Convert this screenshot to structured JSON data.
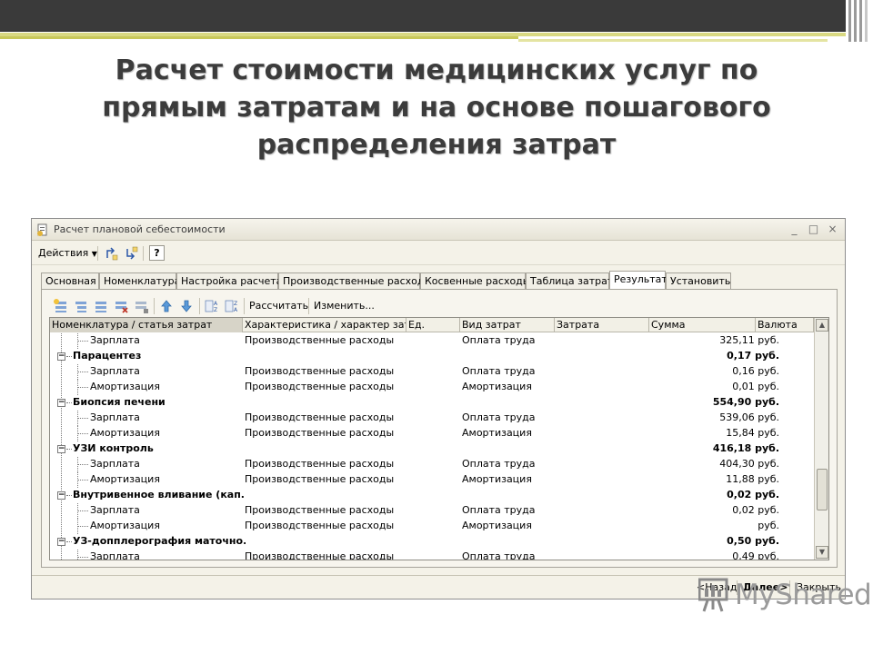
{
  "slide": {
    "title": "Расчет стоимости медицинских услуг по прямым затратам и на основе пошагового распределения затрат"
  },
  "window": {
    "title": "Расчет плановой себестоимости",
    "controls": [
      "_",
      "□",
      "×"
    ]
  },
  "menu": {
    "actions_label": "Действия",
    "help_label": "?"
  },
  "tabs": [
    "Основная",
    "Номенклатура",
    "Настройка расчета",
    "Производственные расходы",
    "Косвенные расходы",
    "Таблица затрат",
    "Результат",
    "Установить"
  ],
  "active_tab": "Результат",
  "toolbar": {
    "calculate_label": "Рассчитать",
    "edit_label": "Изменить..."
  },
  "grid": {
    "columns": [
      "Номенклатура / статья затрат",
      "Характеристика / характер затрат",
      "Ед.",
      "Вид затрат",
      "Затрата",
      "Сумма",
      "Валюта"
    ],
    "rows": [
      {
        "type": "item",
        "name": "Зарплата",
        "character": "Производственные расходы",
        "kind": "Оплата труда",
        "sum": "325,11 руб."
      },
      {
        "type": "group",
        "name": "Парацентез",
        "sum": "0,17 руб."
      },
      {
        "type": "item",
        "name": "Зарплата",
        "character": "Производственные расходы",
        "kind": "Оплата труда",
        "sum": "0,16 руб."
      },
      {
        "type": "item",
        "name": "Амортизация",
        "character": "Производственные расходы",
        "kind": "Амортизация",
        "sum": "0,01 руб."
      },
      {
        "type": "group",
        "name": "Биопсия печени",
        "sum": "554,90 руб."
      },
      {
        "type": "item",
        "name": "Зарплата",
        "character": "Производственные расходы",
        "kind": "Оплата труда",
        "sum": "539,06 руб."
      },
      {
        "type": "item",
        "name": "Амортизация",
        "character": "Производственные расходы",
        "kind": "Амортизация",
        "sum": "15,84 руб."
      },
      {
        "type": "group",
        "name": "УЗИ контроль",
        "sum": "416,18 руб."
      },
      {
        "type": "item",
        "name": "Зарплата",
        "character": "Производственные расходы",
        "kind": "Оплата труда",
        "sum": "404,30 руб."
      },
      {
        "type": "item",
        "name": "Амортизация",
        "character": "Производственные расходы",
        "kind": "Амортизация",
        "sum": "11,88 руб."
      },
      {
        "type": "group",
        "name": "Внутривенное вливание (кап...",
        "sum": "0,02 руб."
      },
      {
        "type": "item",
        "name": "Зарплата",
        "character": "Производственные расходы",
        "kind": "Оплата труда",
        "sum": "0,02 руб."
      },
      {
        "type": "item",
        "name": "Амортизация",
        "character": "Производственные расходы",
        "kind": "Амортизация",
        "sum": "руб."
      },
      {
        "type": "group",
        "name": "УЗ-допплерография маточно...",
        "sum": "0,50 руб."
      },
      {
        "type": "item",
        "name": "Зарплата",
        "character": "Производственные расходы",
        "kind": "Оплата труда",
        "sum": "0,49 руб."
      }
    ]
  },
  "footer": {
    "back_label": "<Назад",
    "next_label": "Далее>",
    "close_label": "Закрыть"
  },
  "watermark": {
    "text": "MyShared"
  }
}
